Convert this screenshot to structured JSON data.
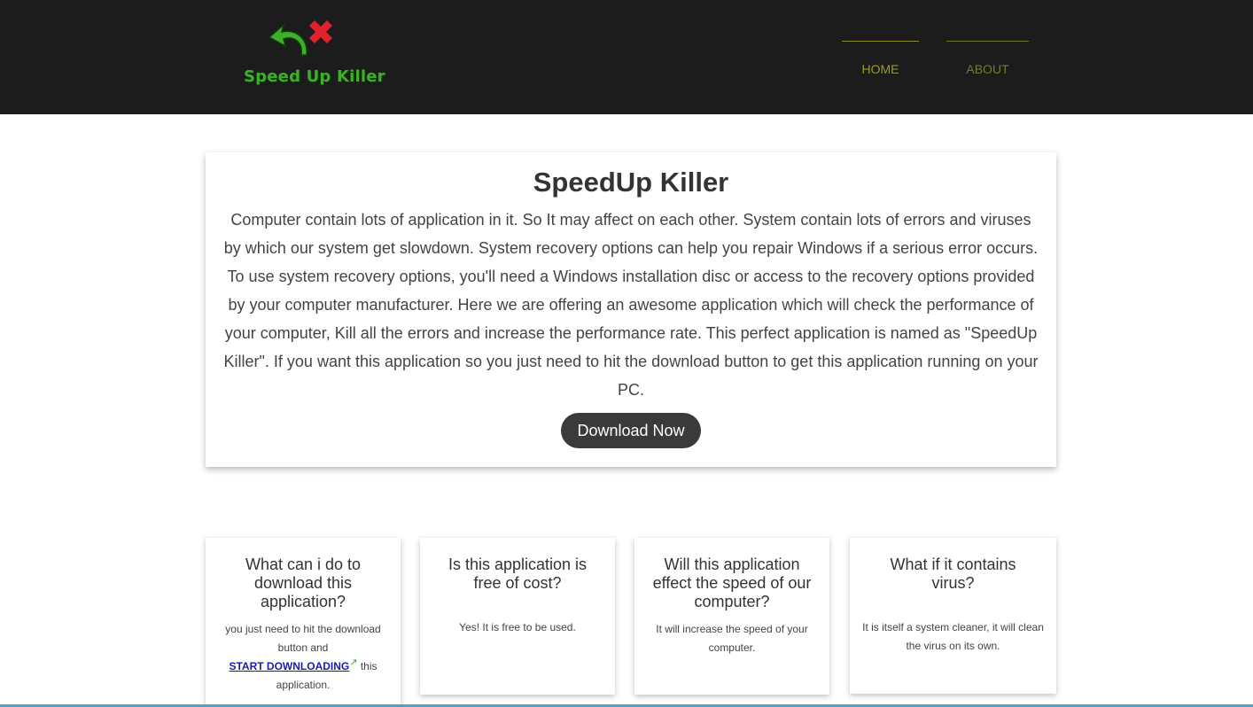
{
  "header": {
    "logo_text": "Speed Up Killer",
    "nav": [
      {
        "label": "HOME"
      },
      {
        "label": "ABOUT"
      }
    ]
  },
  "hero": {
    "title": "SpeedUp Killer",
    "body": "Computer contain lots of application in it. So It may affect on each other. System contain lots of errors and viruses by which our system get slowdown. System recovery options can help you repair Windows if a serious error occurs. To use system recovery options, you'll need a Windows installation disc or access to the recovery options provided by your computer manufacturer. Here we are offering an awesome application which will check the performance of your computer, Kill all the errors and increase the performance rate. This perfect application is named as \"SpeedUp Killer\". If you want this application so you just need to hit the download button to get this application running on your PC.",
    "button_label": "Download Now"
  },
  "faq": [
    {
      "question": "What can i do to download this application?",
      "answer_before": "you just need to hit the download button and",
      "link_text": "START DOWNLOADING",
      "answer_after": "this application."
    },
    {
      "question": "Is this application is free of cost?",
      "answer": "Yes! It is free to be used."
    },
    {
      "question": "Will this application effect the speed of our computer?",
      "answer": "It will increase the speed of your computer."
    },
    {
      "question": "What if it contains virus?",
      "answer": "It is itself a system cleaner, it will clean the virus on its own."
    }
  ],
  "icons": {
    "logo_arrow": "back-arrow-icon",
    "logo_x": "red-x-icon",
    "external_link": "external-link-icon"
  },
  "colors": {
    "header_bg": "#1c1c1c",
    "nav_text": "#8a8a2a",
    "logo_green": "#3fae2a",
    "logo_red": "#e0222a",
    "button_bg": "#3a3a3a"
  }
}
